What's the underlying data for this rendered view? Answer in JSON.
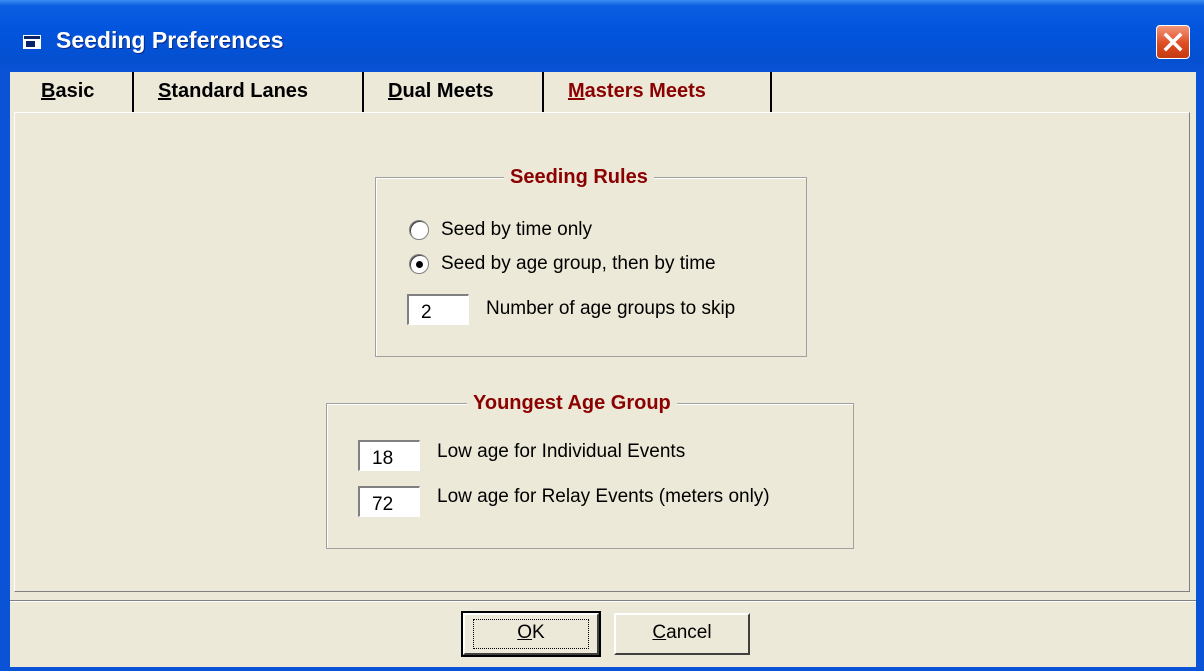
{
  "window": {
    "title": "Seeding Preferences",
    "icons": {
      "app": "window-app-icon",
      "close": "close-icon"
    }
  },
  "tabs": [
    {
      "label": "Basic",
      "mnemonic": "B",
      "rest": "asic",
      "active": false
    },
    {
      "label": "Standard Lanes",
      "mnemonic": "S",
      "rest": "tandard Lanes",
      "active": false
    },
    {
      "label": "Dual Meets",
      "mnemonic": "D",
      "rest": "ual Meets",
      "active": false
    },
    {
      "label": "Masters Meets",
      "mnemonic": "M",
      "rest": "asters Meets",
      "active": true
    }
  ],
  "seeding_rules": {
    "title": "Seeding Rules",
    "options": [
      {
        "label": "Seed by time only",
        "selected": false
      },
      {
        "label": "Seed by age group, then by time",
        "selected": true
      }
    ],
    "skip": {
      "value": "2",
      "label": "Number of age groups to skip"
    }
  },
  "youngest_age_group": {
    "title": "Youngest Age Group",
    "individual": {
      "value": "18",
      "label": "Low age for Individual Events"
    },
    "relay": {
      "value": "72",
      "label": "Low age for Relay Events (meters only)"
    }
  },
  "buttons": {
    "ok": {
      "mnemonic": "O",
      "rest": "K"
    },
    "cancel": {
      "mnemonic": "C",
      "rest": "ancel"
    }
  },
  "colors": {
    "titlebar": "#0a52d6",
    "face": "#ece9d8",
    "accent_text": "#8b0000"
  }
}
